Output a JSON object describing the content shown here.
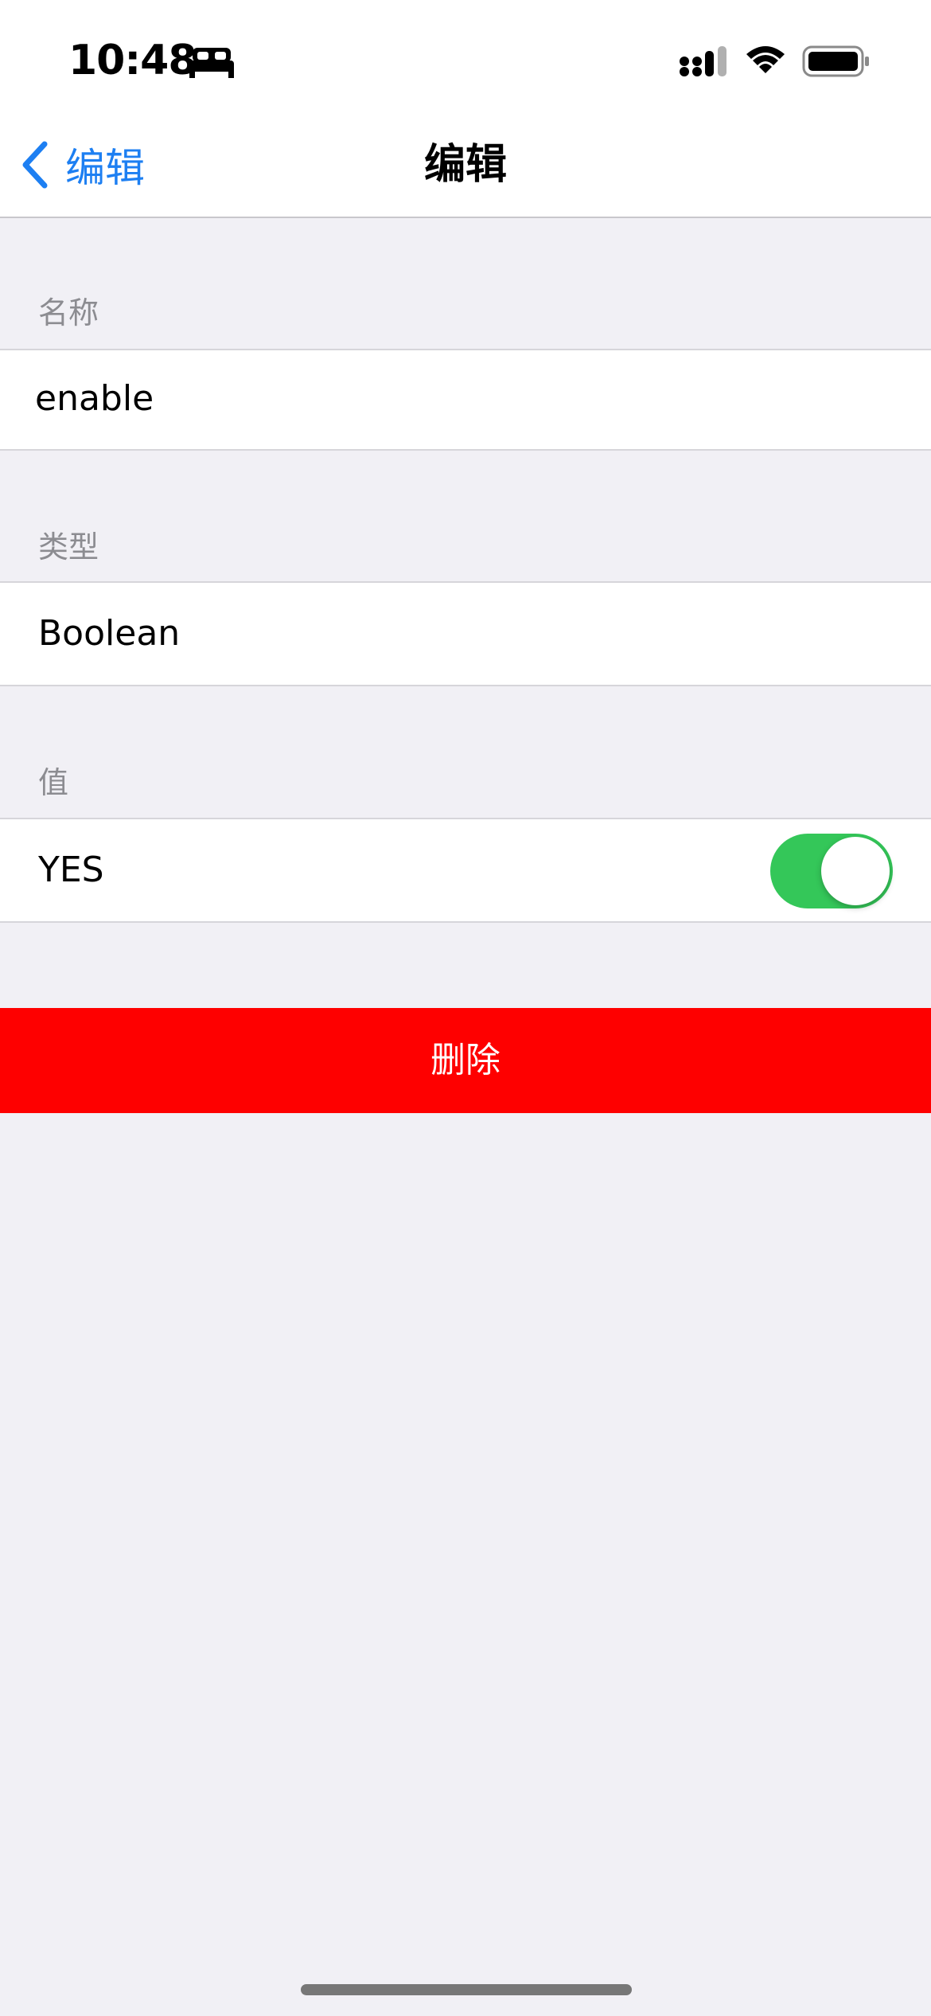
{
  "status_bar": {
    "time": "10:48",
    "icons": [
      "bed-icon",
      "cellular-signal-icon",
      "wifi-icon",
      "battery-icon"
    ]
  },
  "nav": {
    "back_label": "编辑",
    "title": "编辑",
    "accent_color": "#1d7ff2"
  },
  "sections": {
    "name": {
      "header": "名称",
      "value": "enable"
    },
    "type": {
      "header": "类型",
      "value": "Boolean"
    },
    "value": {
      "header": "值",
      "label": "YES",
      "toggle_on": true,
      "toggle_color": "#34c759"
    }
  },
  "delete_button": {
    "label": "删除",
    "color": "#fe0000"
  }
}
